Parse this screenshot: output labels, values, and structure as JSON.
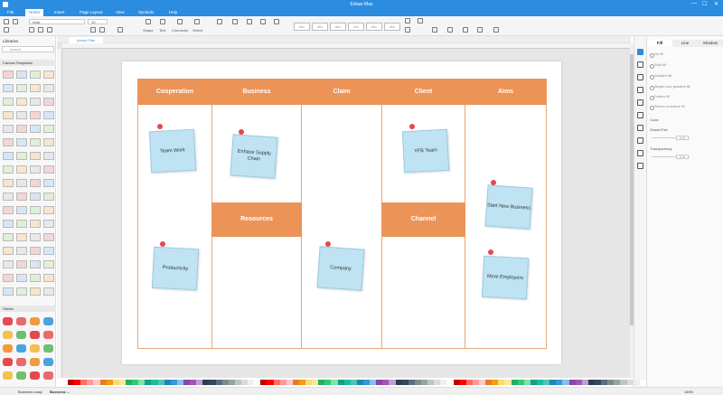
{
  "window": {
    "title": "Edraw Max",
    "minimize": "—",
    "maximize": "☐",
    "close": "✕"
  },
  "menu": {
    "items": [
      "File",
      "Home",
      "Insert",
      "Page Layout",
      "View",
      "Symbols",
      "Help"
    ],
    "active": "Home"
  },
  "ribbon": {
    "font_name": "Arial",
    "font_size": "10",
    "tools": [
      "Shape",
      "Text",
      "Connector",
      "Select"
    ],
    "style_labels": [
      "Abc",
      "Abc",
      "Abc",
      "Abc",
      "Abc",
      "Abc",
      "Abc"
    ]
  },
  "left_panel": {
    "title": "Libraries",
    "search_placeholder": "search",
    "section_templates": "Canvas Templates",
    "section_sticker": "Sticker"
  },
  "tabs": {
    "doc_tab": "Action Plan"
  },
  "canvas": {
    "headers": [
      "Cooperation",
      "Business",
      "Claim",
      "Client",
      "Aims"
    ],
    "mid_headers": [
      "Resources",
      "Channel"
    ],
    "notes": [
      "Team Work",
      "Enhace Supply Chain",
      "YFB Team",
      "Start New Business",
      "Productivity",
      "Company",
      "More Employers"
    ]
  },
  "right_panel": {
    "tabs": [
      "Fill",
      "Line",
      "Shadow"
    ],
    "active_tab": "Fill",
    "fill_options": [
      "No fill",
      "Solid fill",
      "Gradient fill",
      "Single color gradient fill",
      "Pattern fill",
      "Picture or texture fill"
    ],
    "color_label": "Color:",
    "shade_label": "Shade/Tint:",
    "shade_value": "0 %",
    "transparency_label": "Transparency:",
    "transparency_value": "0 %"
  },
  "status": {
    "page_name": "Business analy",
    "page_tab": "Business ...",
    "zoom": "145%"
  },
  "colors": {
    "accent": "#2b8ce0",
    "header_fill": "#ec9357",
    "note_fill": "#bfe3f3",
    "pin": "#e5484d"
  }
}
